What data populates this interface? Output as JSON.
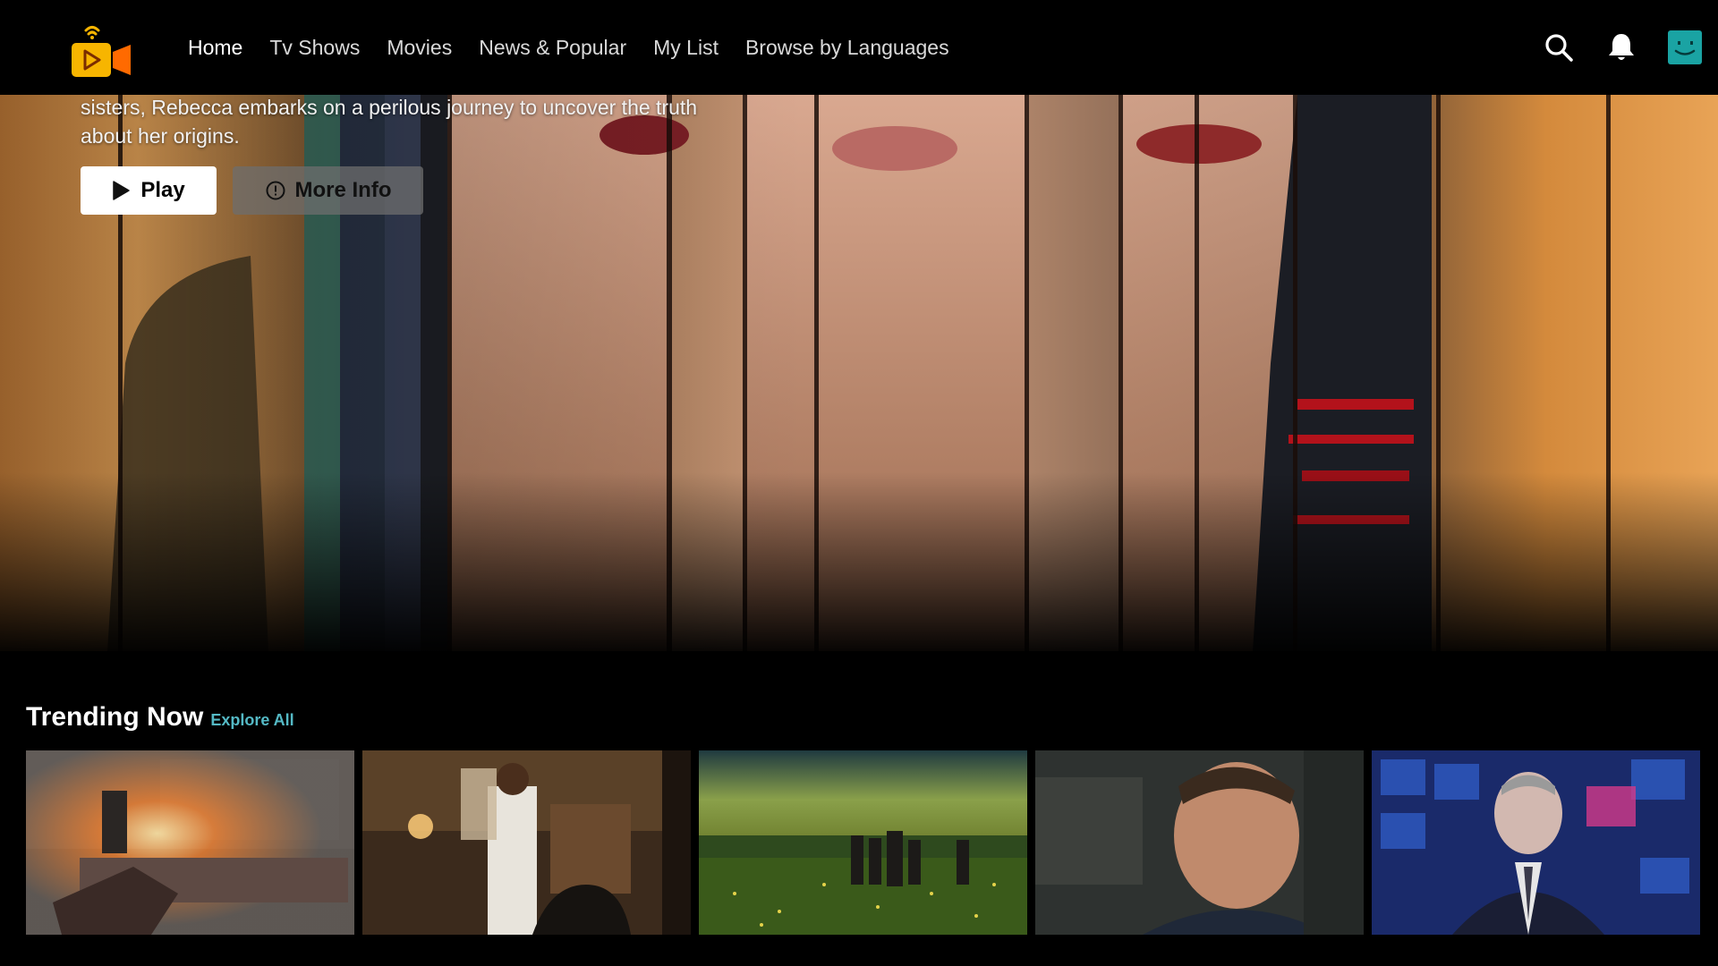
{
  "app": {
    "logo_icon": "play-camera-logo-icon",
    "brand_color_primary": "#f7b500",
    "brand_color_secondary": "#ff6a00"
  },
  "nav": {
    "links": [
      {
        "label": "Home",
        "active": true
      },
      {
        "label": "Tv Shows",
        "active": false
      },
      {
        "label": "Movies",
        "active": false
      },
      {
        "label": "News & Popular",
        "active": false
      },
      {
        "label": "My List",
        "active": false
      },
      {
        "label": "Browse by Languages",
        "active": false
      }
    ],
    "icons": [
      "search-icon",
      "bell-icon"
    ],
    "avatar_color": "#1aa3a3"
  },
  "hero": {
    "description": "sisters, Rebecca embarks on a perilous journey to uncover the truth about her origins.",
    "play_label": "Play",
    "more_info_label": "More Info"
  },
  "trending": {
    "title": "Trending Now",
    "explore_label": "Explore All",
    "accent_color": "#54b9c5",
    "card_count": 5
  }
}
